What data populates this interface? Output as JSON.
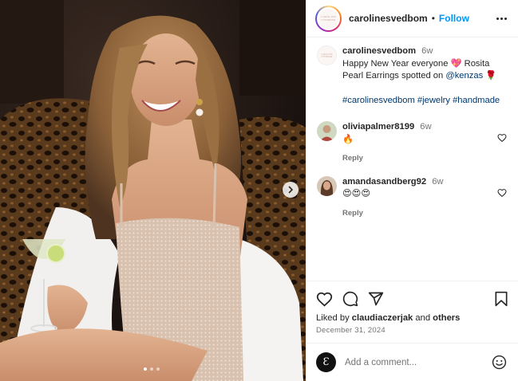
{
  "post": {
    "username": "carolinesvedbom",
    "follow_label": "Follow",
    "separator": "•",
    "brand_logo_lines": [
      "CAROLINE",
      "SVEDBOM"
    ]
  },
  "caption": {
    "username": "carolinesvedbom",
    "time": "6w",
    "text_part1": "Happy New Year everyone 💖 Rosita Pearl Earrings spotted on ",
    "mention": "@kenzas",
    "text_part2": " 🌹",
    "hashtags": [
      "#carolinesvedbom",
      "#jewelry",
      "#handmade"
    ]
  },
  "comments": [
    {
      "username": "oliviapalmer8199",
      "time": "6w",
      "text": "🔥",
      "reply_label": "Reply"
    },
    {
      "username": "amandasandberg92",
      "time": "6w",
      "text": "😍😍😍",
      "reply_label": "Reply"
    }
  ],
  "likes": {
    "prefix": "Liked by ",
    "user": "claudiaczerjak",
    "middle": " and ",
    "others": "others"
  },
  "date": "December 31, 2024",
  "add_comment": {
    "placeholder": "Add a comment...",
    "avatar_glyph": "Ɛ"
  },
  "carousel": {
    "slides": 3,
    "active_index": 0
  },
  "icons": [
    "more-icon",
    "chevron-right-icon",
    "heart-icon",
    "comment-icon",
    "share-icon",
    "bookmark-icon",
    "emoji-icon"
  ],
  "colors": {
    "accent": "#0095f6",
    "text": "#262626",
    "muted": "#737373",
    "link": "#00376b"
  }
}
